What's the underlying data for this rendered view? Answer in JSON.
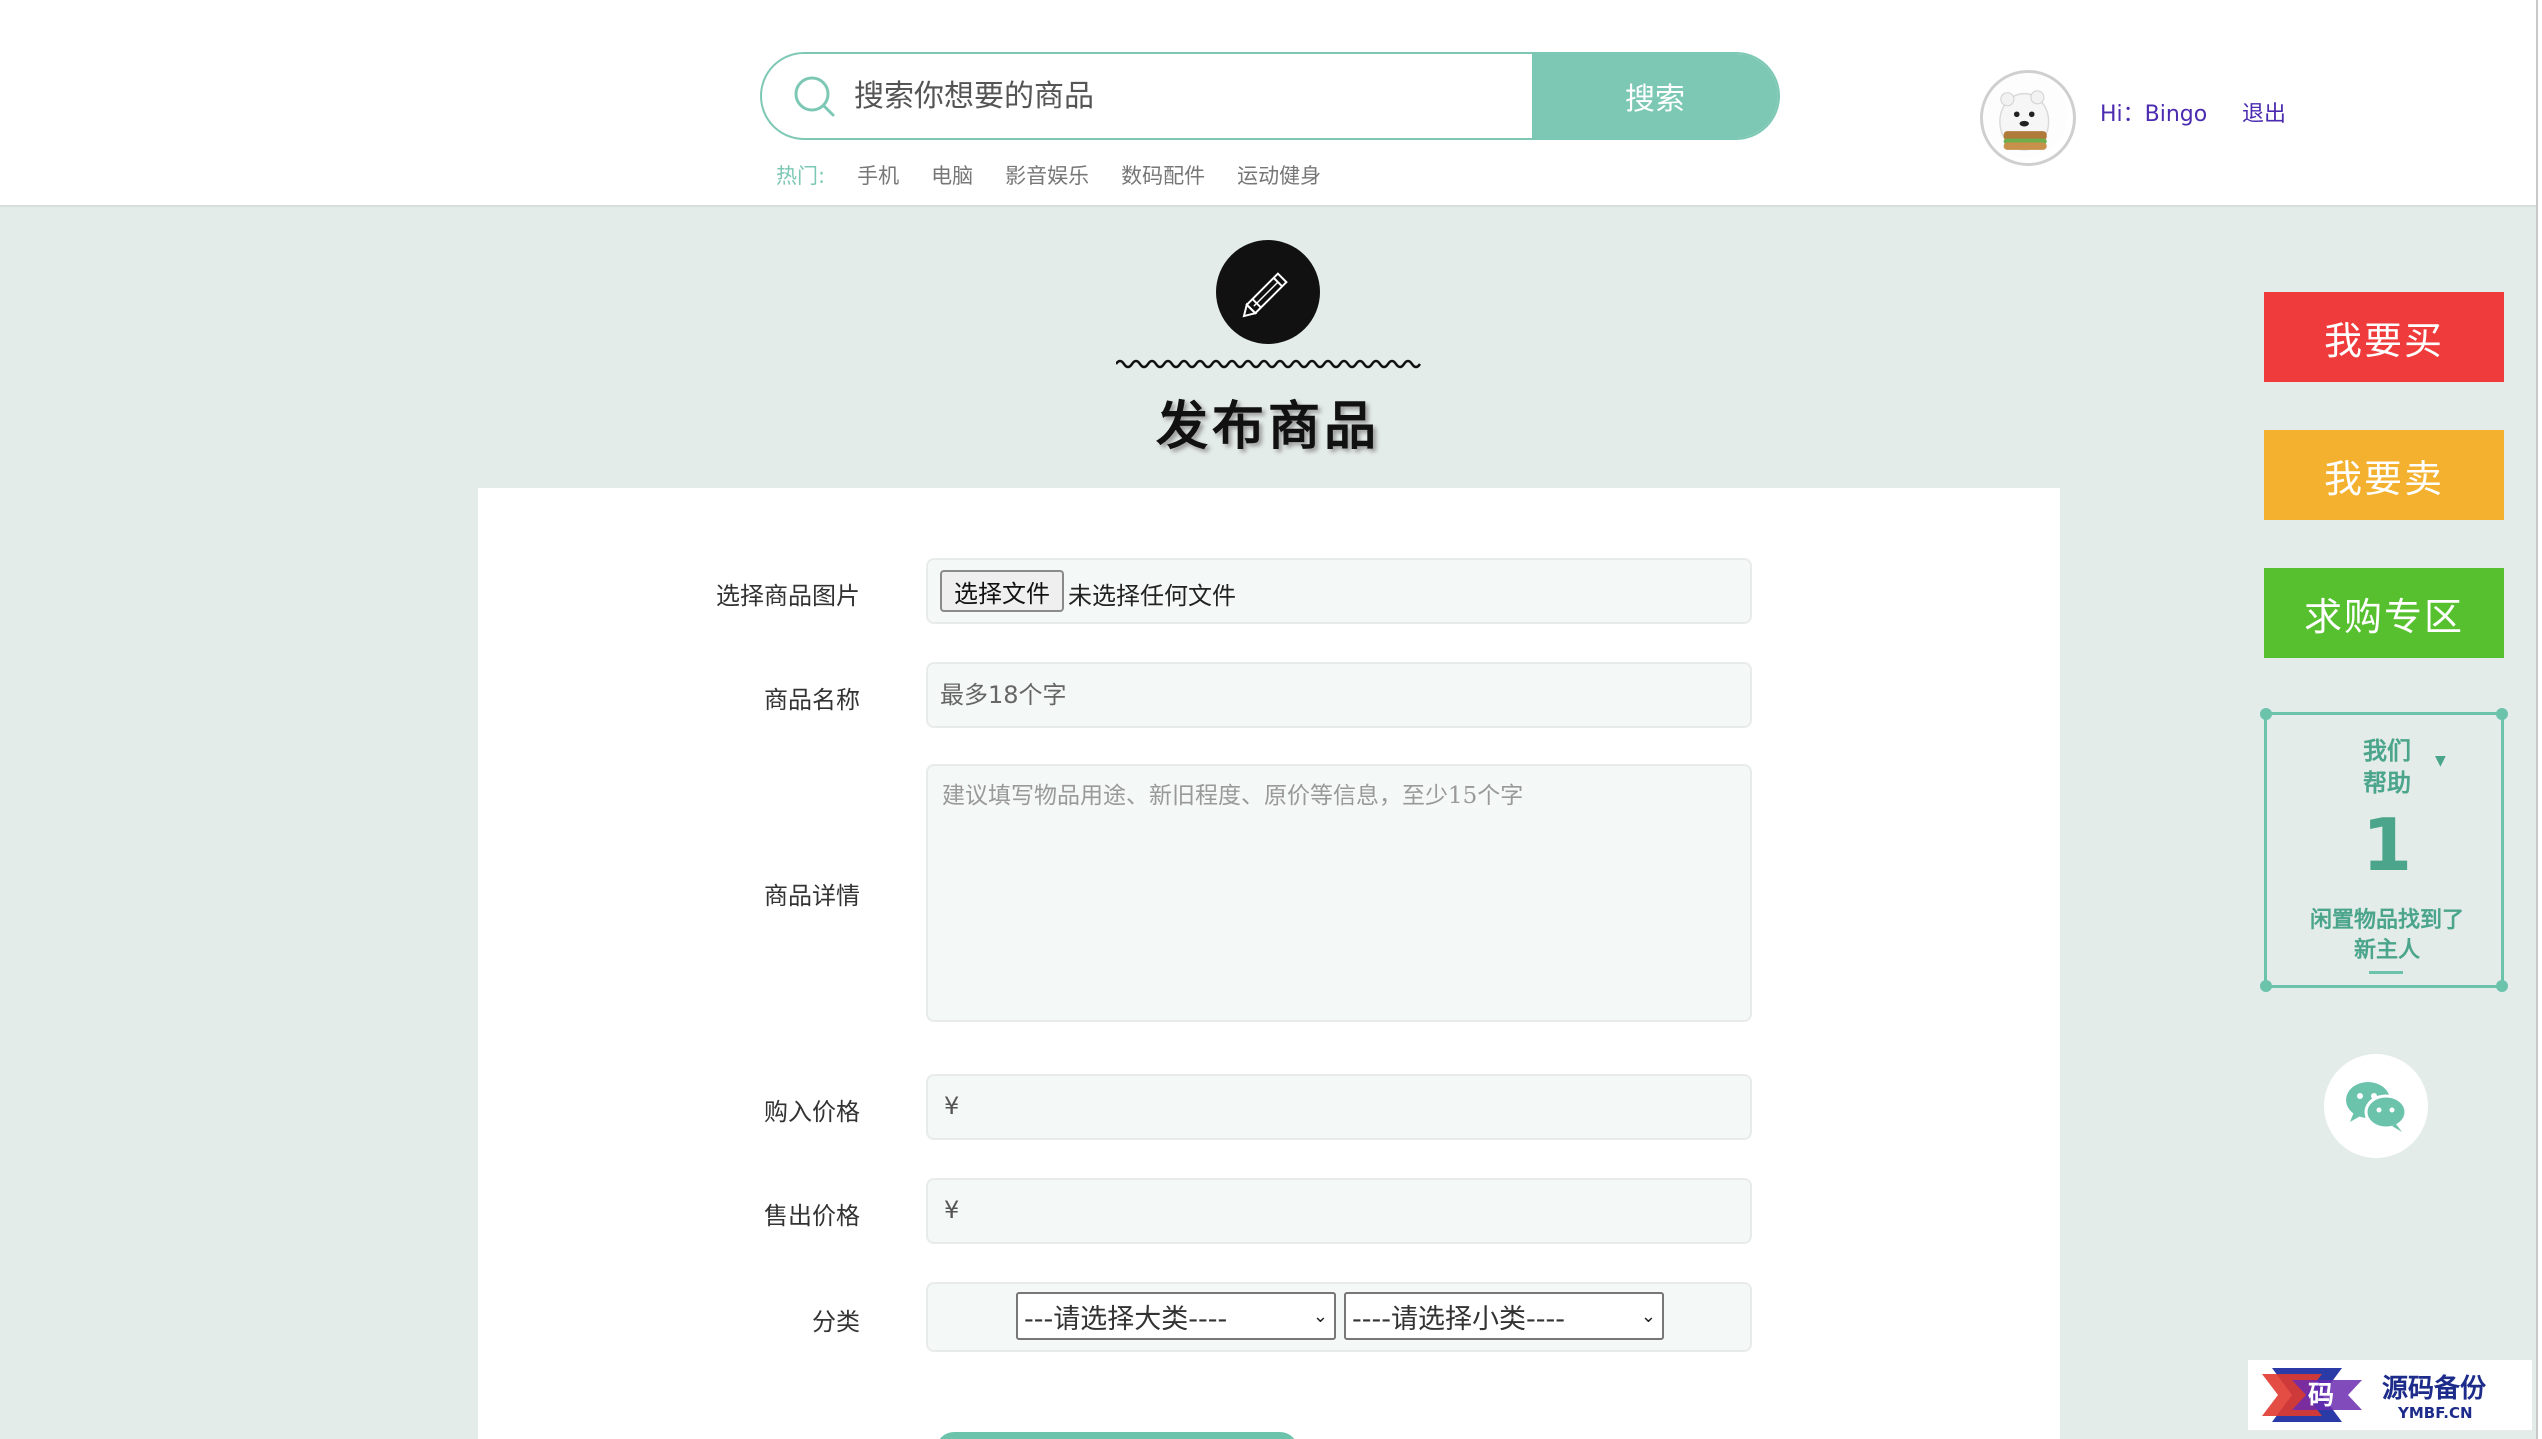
{
  "header": {
    "search_placeholder": "搜索你想要的商品",
    "search_button": "搜索",
    "hot_label": "热门:",
    "hot_links": [
      "手机",
      "电脑",
      "影音娱乐",
      "数码配件",
      "运动健身"
    ],
    "greeting": "Hi：Bingo",
    "logout": "退出"
  },
  "page": {
    "title": "发布商品"
  },
  "form": {
    "image_label": "选择商品图片",
    "file_button": "选择文件",
    "file_status": "未选择任何文件",
    "name_label": "商品名称",
    "name_placeholder": "最多18个字",
    "detail_label": "商品详情",
    "detail_placeholder": "建议填写物品用途、新旧程度、原价等信息，至少15个字",
    "buy_price_label": "购入价格",
    "sell_price_label": "售出价格",
    "currency_symbol": "¥",
    "category_label": "分类",
    "category_major": "---请选择大类----",
    "category_minor": "----请选择小类----"
  },
  "sidebar": {
    "buy": "我要买",
    "sell": "我要卖",
    "want": "求购专区",
    "help_line1": "我们",
    "help_line1b": "帮助",
    "help_count": "1",
    "help_line2": "闲置物品找到了",
    "help_line2b": "新主人"
  },
  "watermark": {
    "glyph": "码",
    "title": "源码备份",
    "sub": "YMBF.CN"
  },
  "colors": {
    "accent": "#7dc8b4",
    "buy": "#ef3b3b",
    "sell": "#f4b12f",
    "want": "#56c02e",
    "background": "#e4ecea"
  }
}
